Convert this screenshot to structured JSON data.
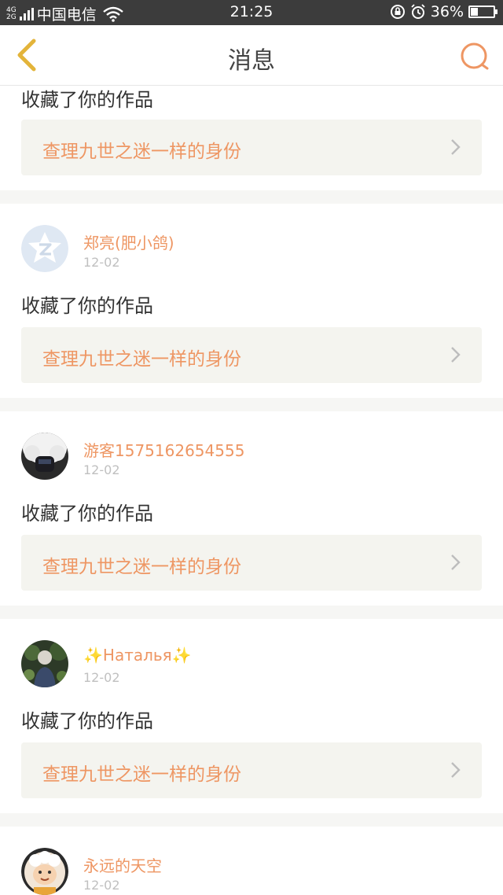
{
  "status_bar": {
    "network_top": "4G",
    "network_bottom": "2G",
    "carrier": "中国电信",
    "time": "21:25",
    "battery": "36%",
    "battery_level": 0.36
  },
  "nav": {
    "title": "消息"
  },
  "messages": [
    {
      "user": "",
      "date": "",
      "action": "收藏了你的作品",
      "work_title": "查理九世之迷一样的身份"
    },
    {
      "user": "郑亮(肥小鸽)",
      "date": "12-02",
      "action": "收藏了你的作品",
      "work_title": "查理九世之迷一样的身份",
      "avatar": "qq-default-avatar"
    },
    {
      "user": "游客1575162654555",
      "date": "12-02",
      "action": "收藏了你的作品",
      "work_title": "查理九世之迷一样的身份",
      "avatar": "photo-avatar-white-hat"
    },
    {
      "user": "✨Наталья✨",
      "date": "12-02",
      "action": "收藏了你的作品",
      "work_title": "查理九世之迷一样的身份",
      "avatar": "photo-avatar-outdoor"
    },
    {
      "user": "永远的天空",
      "date": "12-02",
      "avatar": "cartoon-avatar-sheep"
    }
  ],
  "colors": {
    "accent": "#ee9663",
    "back_arrow": "#e3b43a",
    "date": "#c0c0c0",
    "link_bg": "#f4f4ef"
  }
}
